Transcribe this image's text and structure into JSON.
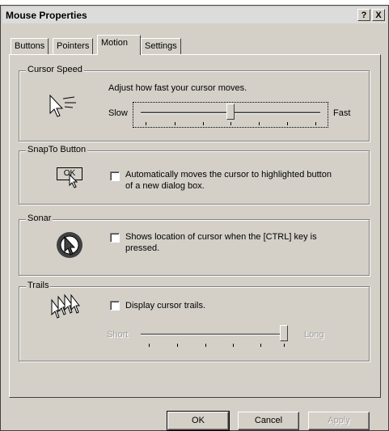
{
  "window": {
    "title": "Mouse Properties",
    "help_glyph": "?",
    "close_glyph": "X"
  },
  "tabs": [
    {
      "label": "Buttons"
    },
    {
      "label": "Pointers"
    },
    {
      "label": "Motion",
      "active": true
    },
    {
      "label": "Settings"
    }
  ],
  "cursor_speed": {
    "legend": "Cursor Speed",
    "description": "Adjust how fast your cursor moves.",
    "slow_label": "Slow",
    "fast_label": "Fast",
    "value_fraction": 0.5,
    "icon": "fast-pointer-icon"
  },
  "snap_to": {
    "legend": "SnapTo Button",
    "icon_label": "OK",
    "checkbox_line1": "Automatically moves the cursor to highlighted button",
    "checkbox_line2": "of a new dialog box.",
    "checked": false,
    "icon": "snapto-ok-icon"
  },
  "sonar": {
    "legend": "Sonar",
    "checkbox_line1": "Shows location of cursor when the [CTRL] key is",
    "checkbox_line2": "pressed.",
    "checked": false,
    "icon": "sonar-icon"
  },
  "trails": {
    "legend": "Trails",
    "checkbox_label": "Display cursor trails.",
    "checked": false,
    "short_label": "Short",
    "long_label": "Long",
    "value_fraction": 1.0,
    "icon": "cursor-trails-icon"
  },
  "buttons": {
    "ok": "OK",
    "cancel": "Cancel",
    "apply": "Apply"
  }
}
